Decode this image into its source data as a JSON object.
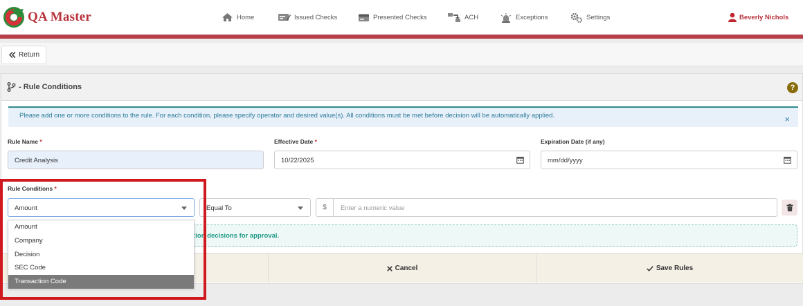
{
  "brand": {
    "name": "QA Master"
  },
  "nav": {
    "items": [
      {
        "label": "Home",
        "icon": "home-icon"
      },
      {
        "label": "Issued Checks",
        "icon": "check-icon"
      },
      {
        "label": "Presented Checks",
        "icon": "card-icon"
      },
      {
        "label": "ACH",
        "icon": "transfer-icon"
      },
      {
        "label": "Exceptions",
        "icon": "alert-light-icon"
      },
      {
        "label": "Settings",
        "icon": "gears-icon"
      }
    ],
    "user": "Beverly Nichols"
  },
  "return_label": "Return",
  "panel": {
    "title": "- Rule Conditions",
    "help": "?",
    "alert": "Please add one or more conditions to the rule. For each condition, please specify operator and desired value(s). All conditions must be met before decision will be automatically applied.",
    "alert_close": "×"
  },
  "form": {
    "rule_name_label": "Rule Name",
    "rule_name_value": "Credit Analysis",
    "effective_date_label": "Effective Date",
    "effective_date_value": "10/22/2025",
    "expiration_date_label": "Expiration Date (if any)",
    "expiration_date_placeholder": "mm/dd/yyyy",
    "required_mark": "*",
    "conditions_label": "Rule Conditions",
    "field_selected": "Amount",
    "operator_selected": "Equal To",
    "currency_symbol": "$",
    "value_placeholder": "Enter a numeric value",
    "info_text": "eption decisions for approval."
  },
  "dropdown": {
    "options": [
      "Amount",
      "Company",
      "Decision",
      "SEC Code",
      "Transaction Code"
    ],
    "highlighted": "Transaction Code"
  },
  "footer": {
    "cancel_label": "Cancel",
    "save_label": "Save Rules"
  },
  "colors": {
    "brand_red": "#b8323a",
    "accent_teal": "#1f9a86",
    "highlight_box": "#d0191f"
  }
}
